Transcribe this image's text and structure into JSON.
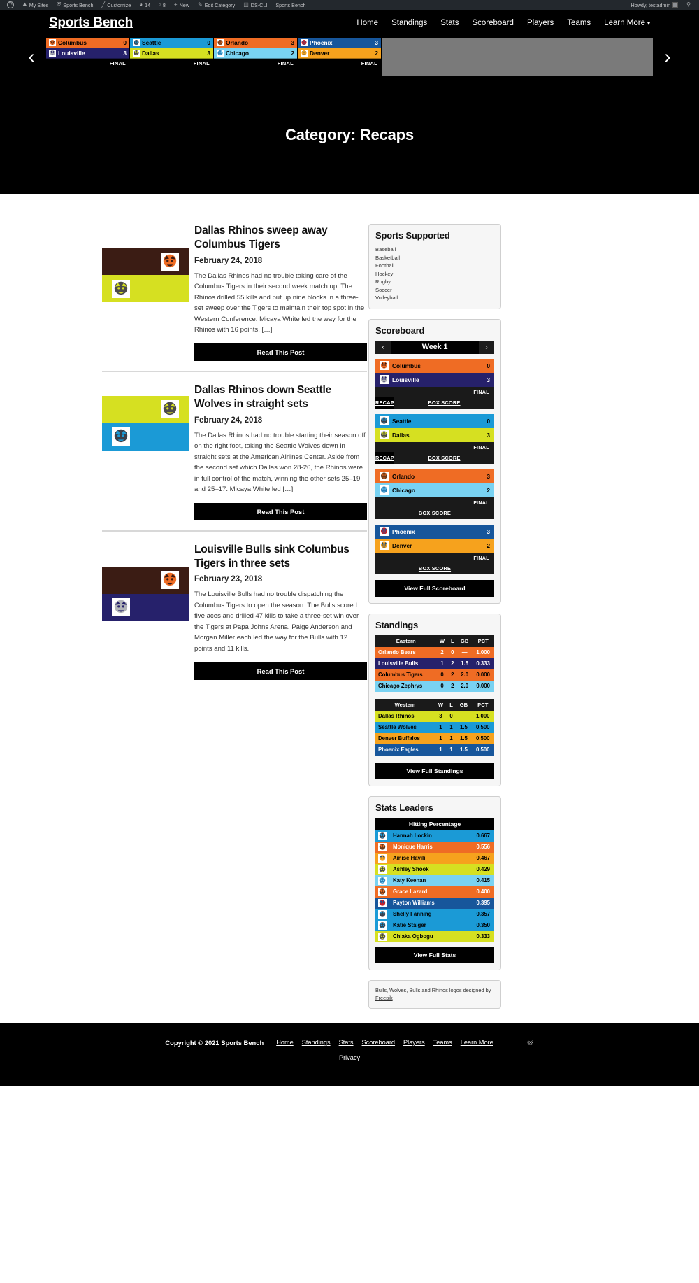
{
  "adminbar": {
    "items": [
      {
        "name": "wp-logo",
        "icon": "wordpress-icon",
        "label": ""
      },
      {
        "name": "my-sites",
        "icon": "sites-icon",
        "label": "My Sites"
      },
      {
        "name": "site-name",
        "icon": "dashboard-icon",
        "label": "Sports Bench"
      },
      {
        "name": "customize",
        "icon": "brush-icon",
        "label": "Customize"
      },
      {
        "name": "updates",
        "icon": "update-icon",
        "label": "14"
      },
      {
        "name": "comments",
        "icon": "comment-icon",
        "label": "8"
      },
      {
        "name": "new-content",
        "icon": "plus-icon",
        "label": "New"
      },
      {
        "name": "edit-category",
        "icon": "pencil-icon",
        "label": "Edit Category"
      },
      {
        "name": "ds-cli",
        "icon": "terminal-icon",
        "label": "DS-CLI"
      },
      {
        "name": "sports-bench",
        "icon": "",
        "label": "Sports Bench"
      }
    ],
    "howdy": "Howdy, testadmin",
    "search_icon": "search-icon"
  },
  "header": {
    "site_title": "Sports Bench",
    "nav": [
      {
        "label": "Home"
      },
      {
        "label": "Standings"
      },
      {
        "label": "Stats"
      },
      {
        "label": "Scoreboard"
      },
      {
        "label": "Players"
      },
      {
        "label": "Teams"
      },
      {
        "label": "Learn More",
        "has_caret": true
      }
    ],
    "prev_arrow": "chevron-left-icon",
    "next_arrow": "chevron-right-icon"
  },
  "ticker": {
    "games": [
      {
        "away": {
          "team": "Columbus",
          "score": "0",
          "bg": "#ef6c24",
          "fg": "#000000",
          "logo": "tigers-logo"
        },
        "home": {
          "team": "Louisville",
          "score": "3",
          "bg": "#26216b",
          "fg": "#ffffff",
          "logo": "bulls-logo"
        },
        "status": "FINAL"
      },
      {
        "away": {
          "team": "Seattle",
          "score": "0",
          "bg": "#1b9ad6",
          "fg": "#000000",
          "logo": "wolves-logo"
        },
        "home": {
          "team": "Dallas",
          "score": "3",
          "bg": "#d6e021",
          "fg": "#000000",
          "logo": "rhinos-logo"
        },
        "status": "FINAL"
      },
      {
        "away": {
          "team": "Orlando",
          "score": "3",
          "bg": "#ef6c24",
          "fg": "#000000",
          "logo": "bears-logo"
        },
        "home": {
          "team": "Chicago",
          "score": "2",
          "bg": "#79d2f2",
          "fg": "#000000",
          "logo": "zephyrs-logo"
        },
        "status": "FINAL"
      },
      {
        "away": {
          "team": "Phoenix",
          "score": "3",
          "bg": "#17569b",
          "fg": "#ffffff",
          "logo": "eagles-logo"
        },
        "home": {
          "team": "Denver",
          "score": "2",
          "bg": "#f6a21d",
          "fg": "#000000",
          "logo": "buffalos-logo"
        },
        "status": "FINAL"
      }
    ]
  },
  "page": {
    "title": "Category: Recaps"
  },
  "posts": [
    {
      "title": "Dallas Rhinos sweep away Columbus Tigers",
      "date": "February 24, 2018",
      "excerpt": "The Dallas Rhinos had no trouble taking care of the Columbus Tigers in their second week match up. The Rhinos drilled 55 kills and put up nine blocks in a three-set sweep over the Tigers to maintain their top spot in the Western Conference. Micaya White led the way for the Rhinos with 16 points, […]",
      "read_label": "Read This Post",
      "thumb": {
        "top_bg": "#3b1c14",
        "top_logo": "tigers-logo",
        "bottom_bg": "#d6e021",
        "bottom_logo": "rhinos-logo"
      }
    },
    {
      "title": "Dallas Rhinos down Seattle Wolves in straight sets",
      "date": "February 24, 2018",
      "excerpt": "The Dallas Rhinos had no trouble starting their season off on the right foot, taking the Seattle Wolves down in straight sets at the American Airlines Center. Aside from the second set which Dallas won 28-26, the Rhinos were in full control of the match, winning the other sets 25–19 and 25–17. Micaya White led […]",
      "read_label": "Read This Post",
      "thumb": {
        "top_bg": "#d6e021",
        "top_logo": "rhinos-logo",
        "bottom_bg": "#1b9ad6",
        "bottom_logo": "wolves-logo"
      }
    },
    {
      "title": "Louisville Bulls sink Columbus Tigers in three sets",
      "date": "February 23, 2018",
      "excerpt": "The Louisville Bulls had no trouble dispatching the Columbus Tigers to open the season. The Bulls scored five aces and drilled 47 kills to take a three-set win over the Tigers at Papa Johns Arena. Paige Anderson and Morgan Miller each led the way for the Bulls with 12 points and 11 kills.",
      "read_label": "Read This Post",
      "thumb": {
        "top_bg": "#3b1c14",
        "top_logo": "tigers-logo",
        "bottom_bg": "#26216b",
        "bottom_logo": "bulls-logo"
      }
    }
  ],
  "sidebar": {
    "sports_supported": {
      "title": "Sports Supported",
      "items": [
        "Baseball",
        "Basketball",
        "Football",
        "Hockey",
        "Rugby",
        "Soccer",
        "Volleyball"
      ]
    },
    "scoreboard": {
      "title": "Scoreboard",
      "week_label": "Week 1",
      "prev_icon": "chevron-left-icon",
      "next_icon": "chevron-right-icon",
      "button_label": "View Full Scoreboard",
      "games": [
        {
          "away": {
            "team": "Columbus",
            "score": "0",
            "bg": "#ef6c24",
            "fg": "#000000",
            "logo": "tigers-logo"
          },
          "home": {
            "team": "Louisville",
            "score": "3",
            "bg": "#26216b",
            "fg": "#ffffff",
            "logo": "bulls-logo"
          },
          "status": "FINAL",
          "links": [
            "RECAP",
            "BOX SCORE"
          ]
        },
        {
          "away": {
            "team": "Seattle",
            "score": "0",
            "bg": "#1b9ad6",
            "fg": "#000000",
            "logo": "wolves-logo"
          },
          "home": {
            "team": "Dallas",
            "score": "3",
            "bg": "#d6e021",
            "fg": "#000000",
            "logo": "rhinos-logo"
          },
          "status": "FINAL",
          "links": [
            "RECAP",
            "BOX SCORE"
          ]
        },
        {
          "away": {
            "team": "Orlando",
            "score": "3",
            "bg": "#ef6c24",
            "fg": "#000000",
            "logo": "bears-logo"
          },
          "home": {
            "team": "Chicago",
            "score": "2",
            "bg": "#79d2f2",
            "fg": "#000000",
            "logo": "zephyrs-logo"
          },
          "status": "FINAL",
          "links": [
            "BOX SCORE"
          ]
        },
        {
          "away": {
            "team": "Phoenix",
            "score": "3",
            "bg": "#17569b",
            "fg": "#ffffff",
            "logo": "eagles-logo"
          },
          "home": {
            "team": "Denver",
            "score": "2",
            "bg": "#f6a21d",
            "fg": "#000000",
            "logo": "buffalos-logo"
          },
          "status": "FINAL",
          "links": [
            "BOX SCORE"
          ]
        }
      ]
    },
    "standings": {
      "title": "Standings",
      "button_label": "View Full Standings",
      "columns": [
        "W",
        "L",
        "GB",
        "PCT"
      ],
      "divisions": [
        {
          "name": "Eastern",
          "rows": [
            {
              "team": "Orlando Bears",
              "w": "2",
              "l": "0",
              "gb": "—",
              "pct": "1.000",
              "bg": "#ef6c24",
              "fg": "#ffffff"
            },
            {
              "team": "Louisville Bulls",
              "w": "1",
              "l": "2",
              "gb": "1.5",
              "pct": "0.333",
              "bg": "#26216b",
              "fg": "#ffffff"
            },
            {
              "team": "Columbus Tigers",
              "w": "0",
              "l": "2",
              "gb": "2.0",
              "pct": "0.000",
              "bg": "#ef6c24",
              "fg": "#000000"
            },
            {
              "team": "Chicago Zephrys",
              "w": "0",
              "l": "2",
              "gb": "2.0",
              "pct": "0.000",
              "bg": "#79d2f2",
              "fg": "#000000"
            }
          ]
        },
        {
          "name": "Western",
          "rows": [
            {
              "team": "Dallas Rhinos",
              "w": "3",
              "l": "0",
              "gb": "—",
              "pct": "1.000",
              "bg": "#d6e021",
              "fg": "#000000"
            },
            {
              "team": "Seattle Wolves",
              "w": "1",
              "l": "1",
              "gb": "1.5",
              "pct": "0.500",
              "bg": "#1b9ad6",
              "fg": "#000000"
            },
            {
              "team": "Denver Buffalos",
              "w": "1",
              "l": "1",
              "gb": "1.5",
              "pct": "0.500",
              "bg": "#f6a21d",
              "fg": "#000000"
            },
            {
              "team": "Phoenix Eagles",
              "w": "1",
              "l": "1",
              "gb": "1.5",
              "pct": "0.500",
              "bg": "#17569b",
              "fg": "#ffffff"
            }
          ]
        }
      ]
    },
    "stats_leaders": {
      "title": "Stats Leaders",
      "stat_header": "Hitting Percentage",
      "button_label": "View Full Stats",
      "rows": [
        {
          "player": "Hannah Lockin",
          "value": "0.667",
          "bg": "#1b9ad6",
          "fg": "#000000",
          "logo": "wolves-logo"
        },
        {
          "player": "Monique Harris",
          "value": "0.556",
          "bg": "#ef6c24",
          "fg": "#ffffff",
          "logo": "bears-logo"
        },
        {
          "player": "Ainise Havili",
          "value": "0.467",
          "bg": "#f6a21d",
          "fg": "#000000",
          "logo": "buffalos-logo"
        },
        {
          "player": "Ashley Shook",
          "value": "0.429",
          "bg": "#d6e021",
          "fg": "#000000",
          "logo": "rhinos-logo"
        },
        {
          "player": "Katy Keenan",
          "value": "0.415",
          "bg": "#79d2f2",
          "fg": "#000000",
          "logo": "zephyrs-logo"
        },
        {
          "player": "Grace Lazard",
          "value": "0.400",
          "bg": "#ef6c24",
          "fg": "#ffffff",
          "logo": "bears-logo"
        },
        {
          "player": "Payton Williams",
          "value": "0.395",
          "bg": "#17569b",
          "fg": "#ffffff",
          "logo": "eagles-logo"
        },
        {
          "player": "Shelly Fanning",
          "value": "0.357",
          "bg": "#1b9ad6",
          "fg": "#000000",
          "logo": "wolves-logo"
        },
        {
          "player": "Katie Staiger",
          "value": "0.350",
          "bg": "#1b9ad6",
          "fg": "#000000",
          "logo": "wolves-logo"
        },
        {
          "player": "Chiaka Ogbogu",
          "value": "0.333",
          "bg": "#d6e021",
          "fg": "#000000",
          "logo": "rhinos-logo"
        }
      ]
    },
    "credit": {
      "text": "Bulls, Wolves, Bulls and Rhinos logos designed by Freepik"
    }
  },
  "footer": {
    "copyright": "Copyright © 2021 Sports Bench",
    "nav": [
      "Home",
      "Standings",
      "Stats",
      "Scoreboard",
      "Players",
      "Teams",
      "Learn More"
    ],
    "privacy": "Privacy",
    "rss_icon": "rss-icon"
  }
}
